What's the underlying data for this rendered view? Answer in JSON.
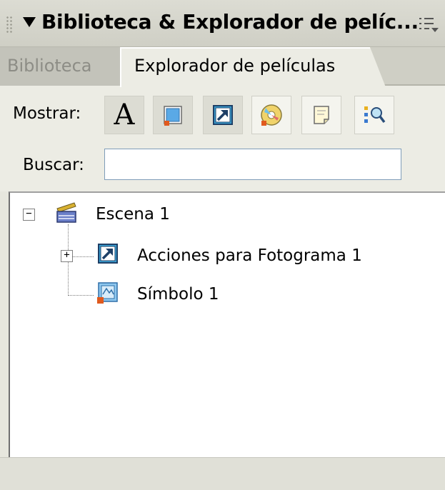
{
  "panel": {
    "title": "Biblioteca & Explorador de pelíc..."
  },
  "tabs": [
    {
      "label": "Biblioteca",
      "active": false
    },
    {
      "label": "Explorador de películas",
      "active": true
    }
  ],
  "toolbar": {
    "show_label": "Mostrar:",
    "search_label": "Buscar:",
    "search_value": "",
    "filter_buttons": [
      {
        "icon": "text-icon",
        "glyph": "A"
      },
      {
        "icon": "buttons-movieclips-graphics-icon"
      },
      {
        "icon": "actionscript-icon"
      },
      {
        "icon": "video-sound-bitmap-icon"
      },
      {
        "icon": "frames-layers-icon"
      },
      {
        "icon": "customize-filter-icon"
      }
    ]
  },
  "tree": {
    "items": [
      {
        "label": "Escena 1",
        "icon": "clapperboard-icon",
        "expanded": true
      },
      {
        "label": "Acciones para Fotograma 1",
        "icon": "action-arrow-icon",
        "expanded": false
      },
      {
        "label": "Símbolo 1",
        "icon": "movieclip-symbol-icon"
      }
    ]
  },
  "colors": {
    "panel_bg": "#ecece4",
    "titlebar_bg": "#d6d6cd",
    "input_border": "#7f9db9"
  }
}
